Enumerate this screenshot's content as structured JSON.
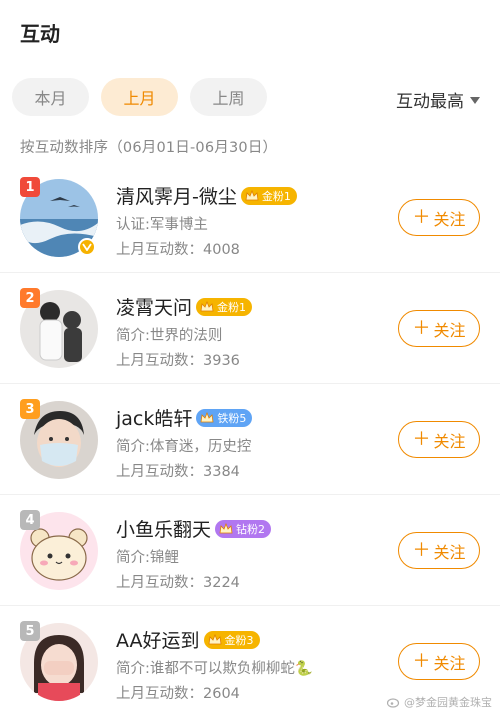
{
  "header": {
    "title": "互动"
  },
  "tabs": [
    {
      "label": "本月",
      "active": false
    },
    {
      "label": "上月",
      "active": true
    },
    {
      "label": "上周",
      "active": false
    }
  ],
  "sort": {
    "label": "互动最高",
    "icon": "caret-down-icon"
  },
  "subtitle": "按互动数排序（06月01日-06月30日）",
  "follow_label": "关注",
  "users": [
    {
      "rank": "1",
      "rank_color": "#f04a3a",
      "name": "清风霁月-微尘",
      "badge": "金粉1",
      "badge_color": "#f6b400",
      "desc": "认证:军事博主",
      "count": "上月互动数：4008",
      "verified": true
    },
    {
      "rank": "2",
      "rank_color": "#ff7a2c",
      "name": "凌霄天问",
      "badge": "金粉1",
      "badge_color": "#f6b400",
      "desc": "简介:世界的法则",
      "count": "上月互动数：3936",
      "verified": false
    },
    {
      "rank": "3",
      "rank_color": "#ff9e1f",
      "name": "jack皓轩",
      "badge": "铁粉5",
      "badge_color": "#5fa4f5",
      "desc": "简介:体育迷，历史控",
      "count": "上月互动数：3384",
      "verified": false
    },
    {
      "rank": "4",
      "rank_color": "#b8b8b8",
      "name": "小鱼乐翻天",
      "badge": "钻粉2",
      "badge_color": "#b177f0",
      "desc": "简介:锦鲤",
      "count": "上月互动数：3224",
      "verified": false
    },
    {
      "rank": "5",
      "rank_color": "#b8b8b8",
      "name": "AA好运到",
      "badge": "金粉3",
      "badge_color": "#f6b400",
      "desc": "简介:谁都不可以欺负柳柳蛇🐍",
      "count": "上月互动数：2604",
      "verified": false
    }
  ],
  "watermark": "@梦金园黄金珠宝"
}
